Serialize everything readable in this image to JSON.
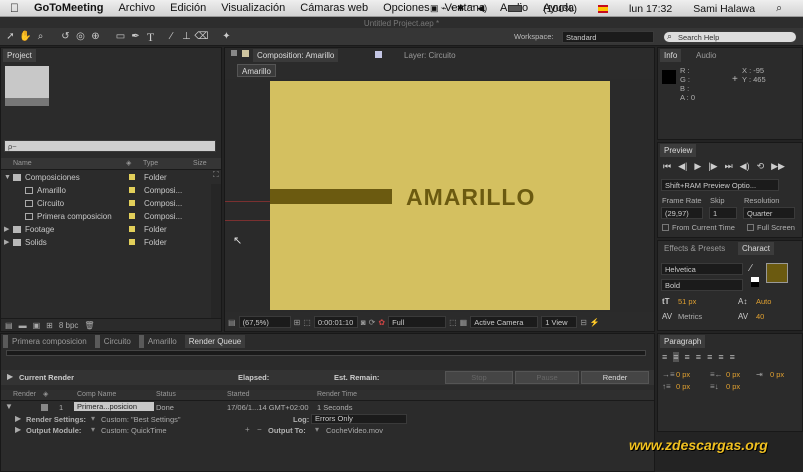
{
  "menubar": {
    "apple": "",
    "app": "GoToMeeting",
    "items": [
      "Archivo",
      "Edición",
      "Visualización",
      "Cámaras web",
      "Opciones",
      "Ventana",
      "Audio",
      "Ayuda"
    ],
    "battery": "(100%)",
    "time": "lun 17:32",
    "user": "Sami Halawa"
  },
  "window_title": "Untitled Project.aep *",
  "toolbar": {
    "workspace_label": "Workspace:",
    "workspace_value": "Standard",
    "search_placeholder": "Search Help"
  },
  "project": {
    "tab": "Project",
    "search_placeholder": "ρ~",
    "columns": [
      "Name",
      "Type",
      "Size"
    ],
    "items": [
      {
        "name": "Composiciones",
        "type": "Folder",
        "kind": "folder",
        "indent": 0
      },
      {
        "name": "Amarillo",
        "type": "Composi...",
        "kind": "comp",
        "indent": 1
      },
      {
        "name": "Circuito",
        "type": "Composi...",
        "kind": "comp",
        "indent": 1
      },
      {
        "name": "Primera composicion",
        "type": "Composi...",
        "kind": "comp",
        "indent": 1
      },
      {
        "name": "Footage",
        "type": "Folder",
        "kind": "folder",
        "indent": 0
      },
      {
        "name": "Solids",
        "type": "Folder",
        "kind": "folder",
        "indent": 0
      }
    ],
    "bpc": "8 bpc"
  },
  "composition": {
    "tab": "Composition: Amarillo",
    "layer_tab": "Layer: Circuito",
    "breadcrumb": "Amarillo",
    "text": "AMARILLO",
    "bg_color": "#d4c060",
    "bar_color": "#6b5a10",
    "zoom": "(67,5%)",
    "timecode": "0:00:01:10",
    "resolution": "Full",
    "camera": "Active Camera",
    "view": "1 View"
  },
  "info": {
    "tabs": [
      "Info",
      "Audio"
    ],
    "r": "R :",
    "g": "G :",
    "b": "B :",
    "a": "A : 0",
    "x": "X : -95",
    "y": "Y : 465"
  },
  "preview": {
    "tab": "Preview",
    "ram_option": "Shift+RAM Preview Optio...",
    "frame_rate_label": "Frame Rate",
    "skip_label": "Skip",
    "resolution_label": "Resolution",
    "frame_rate": "(29,97)",
    "skip": "1",
    "resolution": "Quarter",
    "from_current": "From Current Time",
    "full_screen": "Full Screen"
  },
  "character": {
    "tabs": [
      "Effects & Presets",
      "Charact"
    ],
    "font": "Helvetica",
    "style": "Bold",
    "size": "51 px",
    "leading": "Auto",
    "kerning": "Metrics",
    "tracking": "40",
    "color": "#6b5a10"
  },
  "paragraph": {
    "tab": "Paragraph",
    "values": [
      "0 px",
      "0 px",
      "0 px",
      "0 px",
      "0 px"
    ]
  },
  "render_queue": {
    "tabs": [
      "Primera composicion",
      "Circuito",
      "Amarillo",
      "Render Queue"
    ],
    "current_render": "Current Render",
    "elapsed": "Elapsed:",
    "est_remain": "Est. Remain:",
    "stop": "Stop",
    "pause": "Pause",
    "render": "Render",
    "columns": [
      "Render",
      "Comp Name",
      "Status",
      "Started",
      "Render Time"
    ],
    "item": {
      "num": "1",
      "comp": "Primera...posicion",
      "status": "Done",
      "started": "17/06/1...14 GMT+02:00",
      "time": "1 Seconds"
    },
    "render_settings_label": "Render Settings:",
    "render_settings": "Custom: \"Best Settings\"",
    "log_label": "Log:",
    "log": "Errors Only",
    "output_module_label": "Output Module:",
    "output_module": "Custom: QuickTime",
    "output_to_label": "Output To:",
    "output_to": "CocheVideo.mov"
  },
  "watermark": "www.zdescargas.org"
}
